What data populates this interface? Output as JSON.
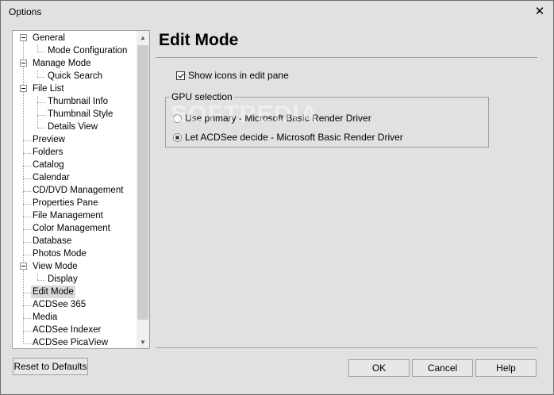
{
  "window": {
    "title": "Options"
  },
  "tree": {
    "items": [
      {
        "label": "General"
      },
      {
        "label": "Mode Configuration"
      },
      {
        "label": "Manage Mode"
      },
      {
        "label": "Quick Search"
      },
      {
        "label": "File List"
      },
      {
        "label": "Thumbnail Info"
      },
      {
        "label": "Thumbnail Style"
      },
      {
        "label": "Details View"
      },
      {
        "label": "Preview"
      },
      {
        "label": "Folders"
      },
      {
        "label": "Catalog"
      },
      {
        "label": "Calendar"
      },
      {
        "label": "CD/DVD Management"
      },
      {
        "label": "Properties Pane"
      },
      {
        "label": "File Management"
      },
      {
        "label": "Color Management"
      },
      {
        "label": "Database"
      },
      {
        "label": "Photos Mode"
      },
      {
        "label": "View Mode"
      },
      {
        "label": "Display"
      },
      {
        "label": "Edit Mode"
      },
      {
        "label": "ACDSee 365"
      },
      {
        "label": "Media"
      },
      {
        "label": "ACDSee Indexer"
      },
      {
        "label": "ACDSee PicaView"
      }
    ],
    "selected": "Edit Mode"
  },
  "panel": {
    "heading": "Edit Mode",
    "show_icons_label": "Show icons in edit pane",
    "gpu_group_label": "GPU selection",
    "radio_primary": "Use primary - Microsoft Basic Render Driver",
    "radio_acdsee": "Let ACDSee decide - Microsoft Basic Render Driver",
    "watermark": "SOFTPEDIA"
  },
  "buttons": {
    "reset": "Reset to Defaults",
    "ok": "OK",
    "cancel": "Cancel",
    "help": "Help"
  }
}
